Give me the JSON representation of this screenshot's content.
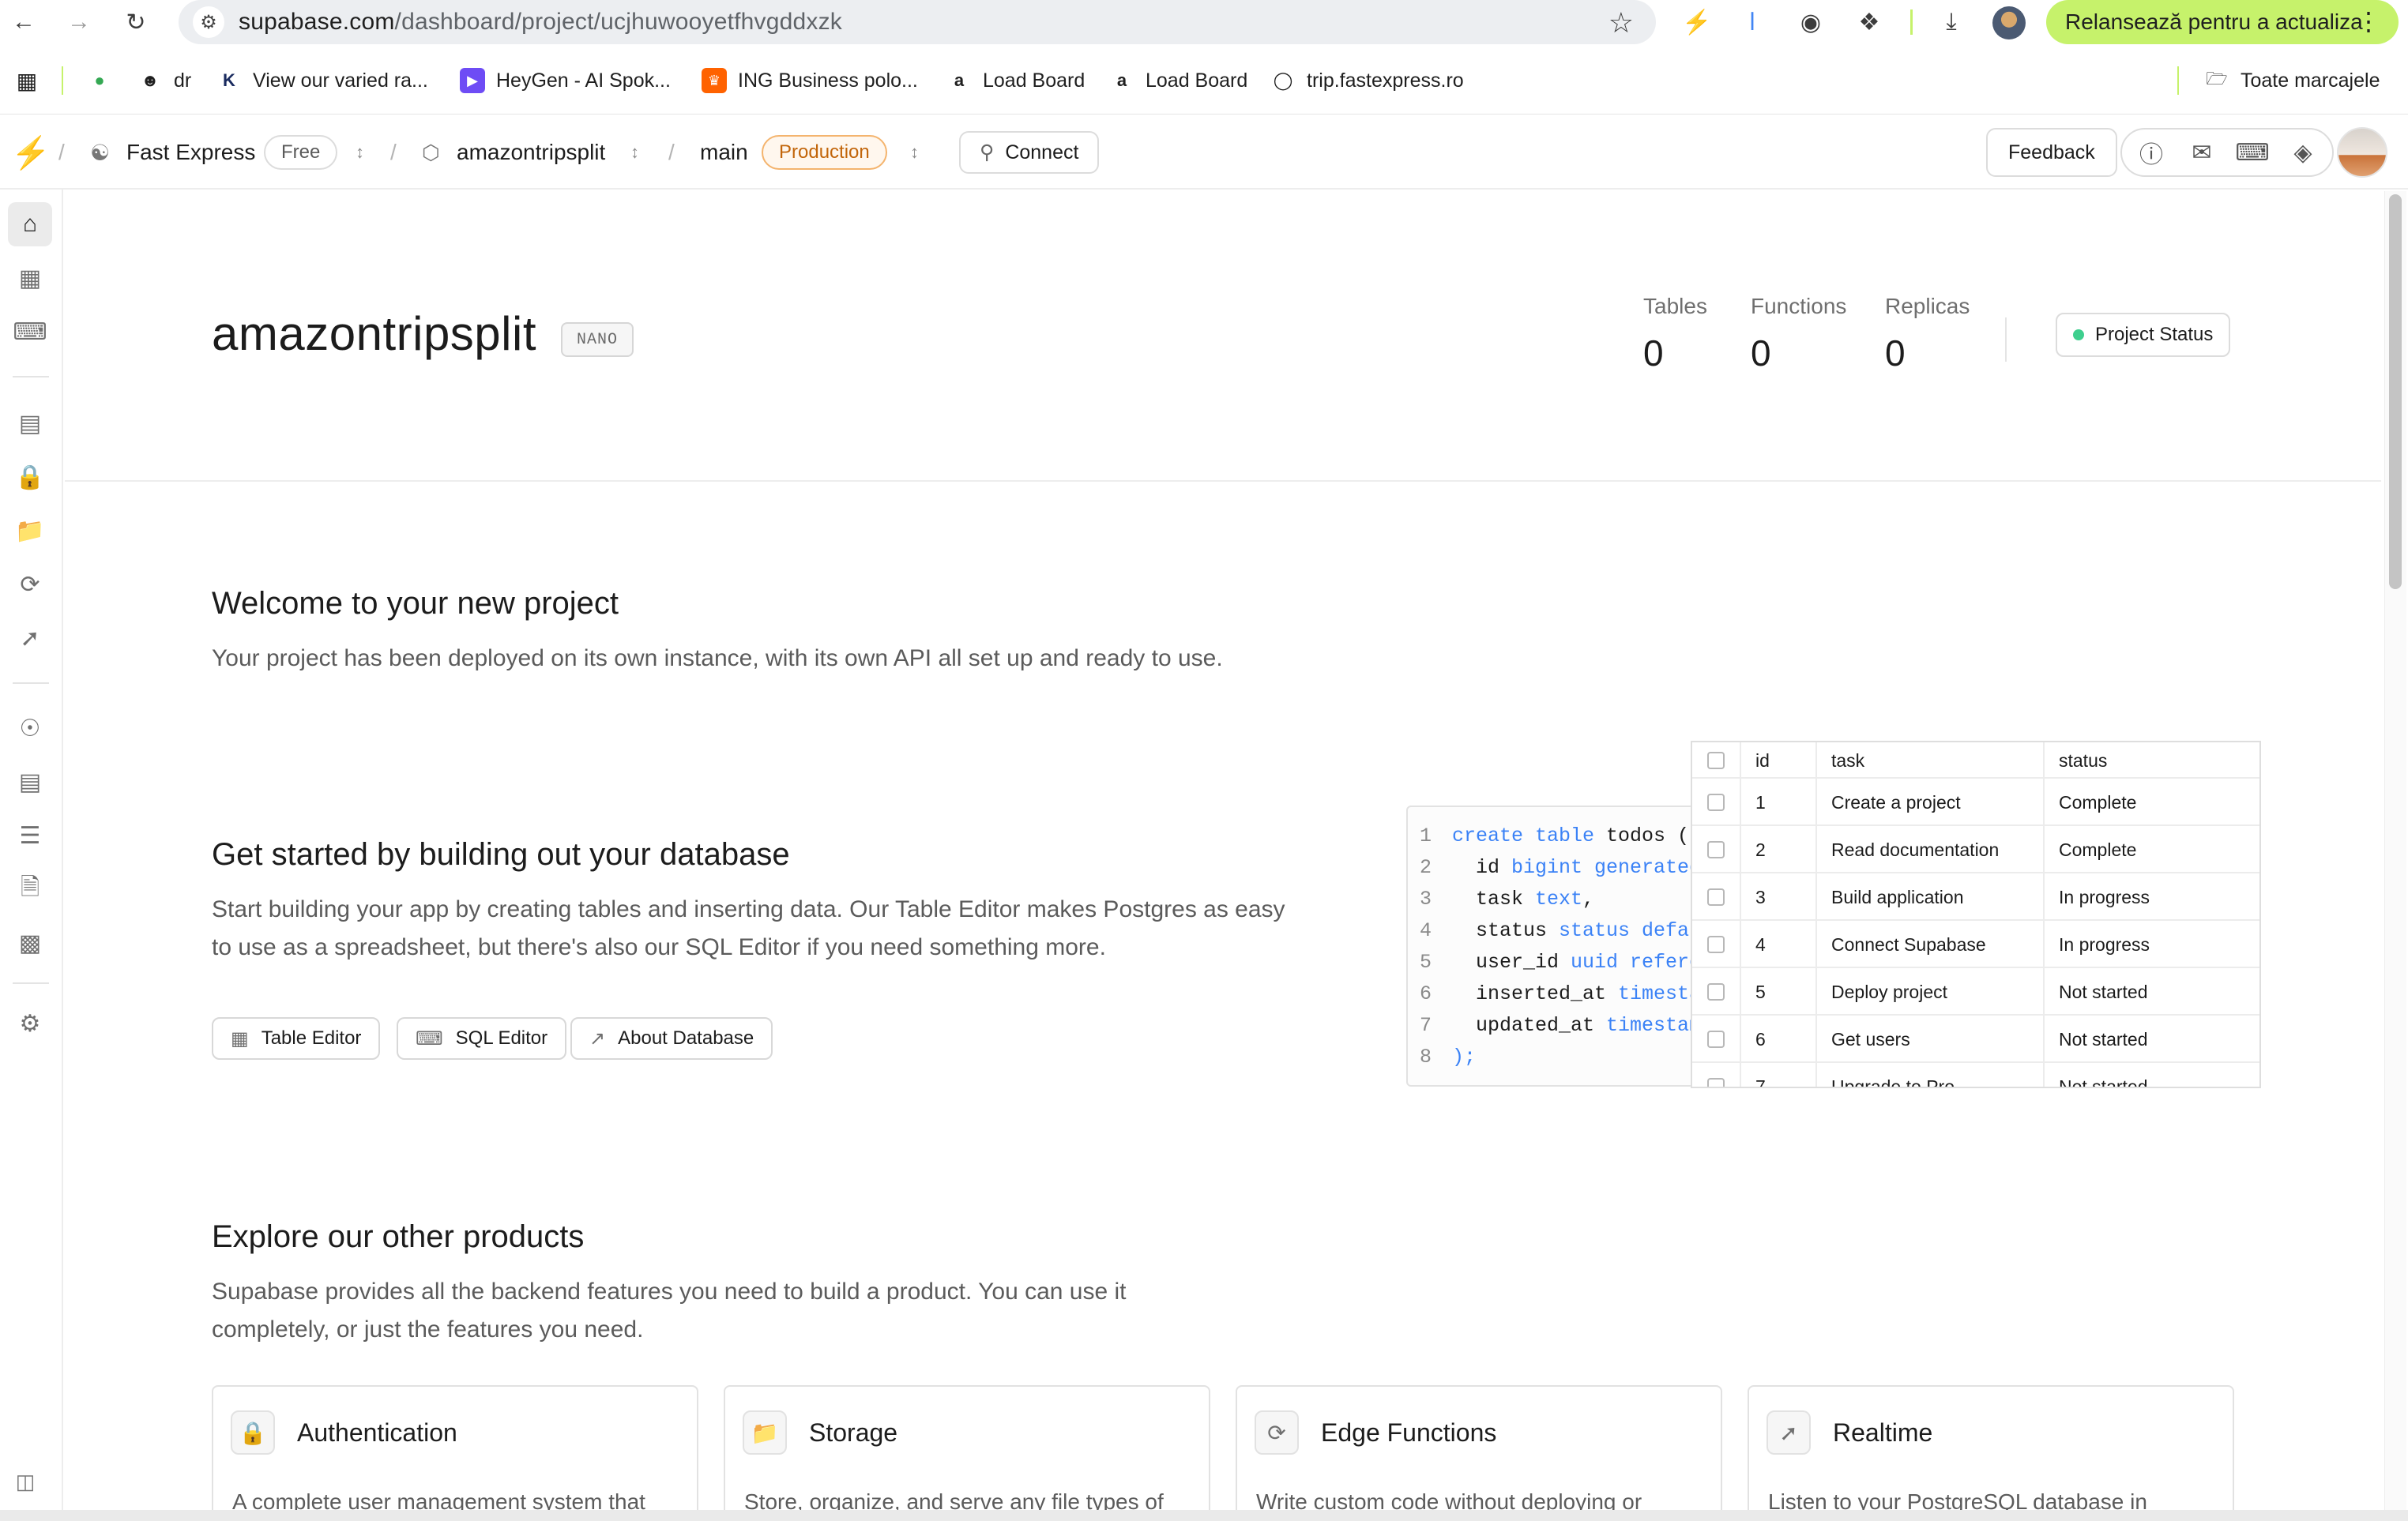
{
  "browser": {
    "url_host": "supabase.com",
    "url_path": "/dashboard/project/ucjhuwooyetfhvgddxzk",
    "update_button": "Relansează pentru a actualiza",
    "bookmarks": [
      {
        "label": "dr",
        "icon": "github-icon"
      },
      {
        "label": "View our varied ra...",
        "icon": "k-logo-icon"
      },
      {
        "label": "HeyGen - AI Spok...",
        "icon": "heygen-icon"
      },
      {
        "label": "ING Business polo...",
        "icon": "ing-lion-icon"
      },
      {
        "label": "Load Board",
        "icon": "amazon-icon"
      },
      {
        "label": "Load Board",
        "icon": "amazon-icon"
      },
      {
        "label": "trip.fastexpress.ro",
        "icon": "globe-icon"
      }
    ],
    "all_bookmarks": "Toate marcajele"
  },
  "header": {
    "org_name": "Fast Express",
    "org_plan": "Free",
    "project_name": "amazontripsplit",
    "branch": "main",
    "branch_badge": "Production",
    "connect": "Connect",
    "feedback": "Feedback"
  },
  "project": {
    "title": "amazontripsplit",
    "tier": "NANO",
    "stats": [
      {
        "label": "Tables",
        "value": "0"
      },
      {
        "label": "Functions",
        "value": "0"
      },
      {
        "label": "Replicas",
        "value": "0"
      }
    ],
    "status_button": "Project Status"
  },
  "welcome": {
    "title": "Welcome to your new project",
    "text": "Your project has been deployed on its own instance, with its own API all set up and ready to use."
  },
  "database": {
    "title": "Get started by building out your database",
    "text_line1": "Start building your app by creating tables and inserting data. Our Table Editor makes Postgres as easy",
    "text_line2": "to use as a spreadsheet, but there's also our SQL Editor if you need something more.",
    "buttons": [
      "Table Editor",
      "SQL Editor",
      "About Database"
    ],
    "code_lines": [
      {
        "n": "1",
        "parts": [
          [
            "kw",
            "create table"
          ],
          [
            "tx",
            " todos ("
          ]
        ]
      },
      {
        "n": "2",
        "parts": [
          [
            "tx",
            "  id "
          ],
          [
            "kw",
            "bigint generated"
          ]
        ]
      },
      {
        "n": "3",
        "parts": [
          [
            "tx",
            "  task "
          ],
          [
            "kw",
            "text"
          ],
          [
            "tx",
            ","
          ]
        ]
      },
      {
        "n": "4",
        "parts": [
          [
            "tx",
            "  status "
          ],
          [
            "kw",
            "status default"
          ]
        ]
      },
      {
        "n": "5",
        "parts": [
          [
            "tx",
            "  user_id "
          ],
          [
            "kw",
            "uuid references"
          ]
        ]
      },
      {
        "n": "6",
        "parts": [
          [
            "tx",
            "  inserted_at "
          ],
          [
            "kw",
            "timestamp"
          ]
        ]
      },
      {
        "n": "7",
        "parts": [
          [
            "tx",
            "  updated_at "
          ],
          [
            "kw",
            "timestamp"
          ]
        ]
      },
      {
        "n": "8",
        "parts": [
          [
            "kw",
            ");"
          ]
        ]
      }
    ],
    "table": {
      "columns": [
        "id",
        "task",
        "status"
      ],
      "rows": [
        [
          "1",
          "Create a project",
          "Complete"
        ],
        [
          "2",
          "Read documentation",
          "Complete"
        ],
        [
          "3",
          "Build application",
          "In progress"
        ],
        [
          "4",
          "Connect Supabase",
          "In progress"
        ],
        [
          "5",
          "Deploy project",
          "Not started"
        ],
        [
          "6",
          "Get users",
          "Not started"
        ],
        [
          "7",
          "Upgrade to Pro",
          "Not started"
        ]
      ]
    }
  },
  "products": {
    "title": "Explore our other products",
    "text_line1": "Supabase provides all the backend features you need to build a product. You can use it",
    "text_line2": "completely, or just the features you need.",
    "cards": [
      {
        "title": "Authentication",
        "desc": "A complete user management system that",
        "icon": "lock-icon"
      },
      {
        "title": "Storage",
        "desc": "Store, organize, and serve any file types of",
        "icon": "folder-icon"
      },
      {
        "title": "Edge Functions",
        "desc": "Write custom code without deploying or",
        "icon": "edge-function-icon"
      },
      {
        "title": "Realtime",
        "desc": "Listen to your PostgreSQL database in",
        "icon": "cursor-click-icon"
      }
    ]
  },
  "colors": {
    "accent": "#3ecf8e",
    "production_badge": "#c2650a",
    "update_button": "#c6f26b",
    "code_keyword": "#3b82f6"
  }
}
